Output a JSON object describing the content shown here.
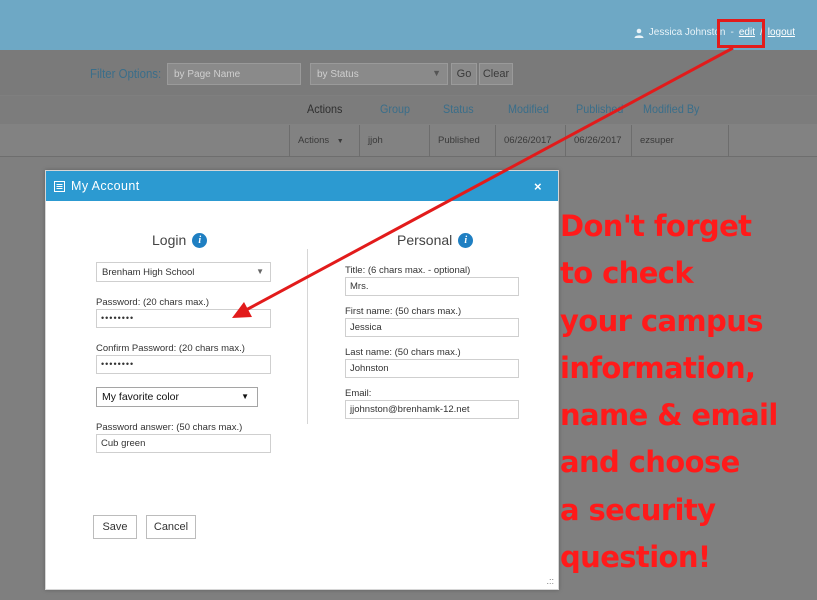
{
  "header": {
    "user_name": "Jessica Johnston",
    "dash": "-",
    "edit_label": "edit",
    "slash": "/",
    "logout_label": "logout"
  },
  "filter": {
    "label": "Filter Options:",
    "page_name_placeholder": "by Page Name",
    "status_value": "by Status",
    "go_label": "Go",
    "clear_label": "Clear"
  },
  "table": {
    "columns": [
      "Actions",
      "Group",
      "Status",
      "Modified",
      "Published",
      "Modified By"
    ],
    "row": {
      "actions": "Actions",
      "group": "jjoh",
      "status": "Published",
      "modified": "06/26/2017",
      "published": "06/26/2017",
      "modified_by": "ezsuper"
    }
  },
  "modal": {
    "title": "My Account",
    "close": "×",
    "login": {
      "title": "Login",
      "campus": "Brenham High School",
      "password_label": "Password: (20 chars max.)",
      "password_value": "••••••••",
      "confirm_label": "Confirm Password: (20 chars max.)",
      "confirm_value": "••••••••",
      "question": "My favorite color",
      "answer_label": "Password answer: (50 chars max.)",
      "answer_value": "Cub green"
    },
    "personal": {
      "title": "Personal",
      "title_label": "Title: (6 chars max. - optional)",
      "title_value": "Mrs.",
      "first_label": "First name: (50 chars max.)",
      "first_value": "Jessica",
      "last_label": "Last name: (50 chars max.)",
      "last_value": "Johnston",
      "email_label": "Email:",
      "email_value": "jjohnston@brenhamk-12.net"
    },
    "save_label": "Save",
    "cancel_label": "Cancel"
  },
  "callout": {
    "lines": [
      "Don't forget",
      "to check",
      "your campus",
      "information,",
      "name & email",
      "and choose",
      "a security",
      "question!"
    ]
  },
  "colors": {
    "topbar": "#6ea8c5",
    "modal_header": "#2c9ad1",
    "callout_red": "#ff1a1a",
    "info_blue": "#1f7fc2"
  }
}
